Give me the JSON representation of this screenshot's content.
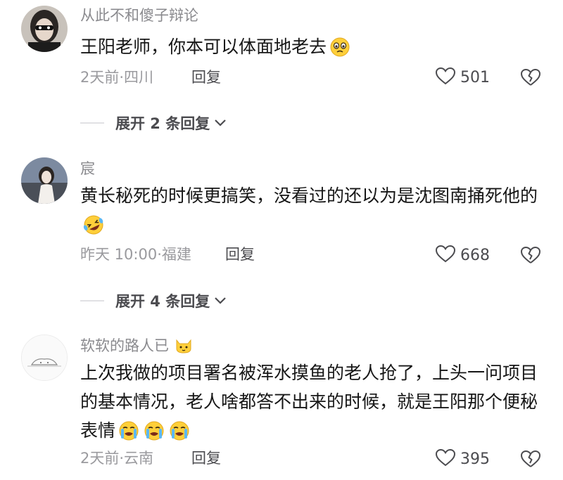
{
  "comments": [
    {
      "username": "从此不和傻子辩论",
      "text": "王阳老师，你本可以体面地老去",
      "emojis": [
        "pleading-face-emoji"
      ],
      "time_location": "2天前·四川",
      "reply_label": "回复",
      "likes": "501",
      "expand_label": "展开 2 条回复"
    },
    {
      "username": "宸",
      "text": "黄长秘死的时候更搞笑，没看过的还以为是沈图南捅死他的",
      "emojis": [
        "rolling-laughing-emoji"
      ],
      "time_location": "昨天 10:00·福建",
      "reply_label": "回复",
      "likes": "668",
      "expand_label": "展开 4 条回复"
    },
    {
      "username": "软软的路人已",
      "username_icon": "cat-face-icon",
      "text": "上次我做的项目署名被浑水摸鱼的老人抢了，上头一问项目的基本情况，老人啥都答不出来的时候，就是王阳那个便秘表情",
      "emojis": [
        "loudly-crying-emoji",
        "loudly-crying-emoji",
        "loudly-crying-emoji"
      ],
      "time_location": "2天前·云南",
      "reply_label": "回复",
      "likes": "395"
    }
  ],
  "colors": {
    "text_primary": "#161616",
    "text_secondary": "#8a8a8e",
    "action_text": "#4b4b4f",
    "emoji_yellow": "#ffcf3a"
  }
}
